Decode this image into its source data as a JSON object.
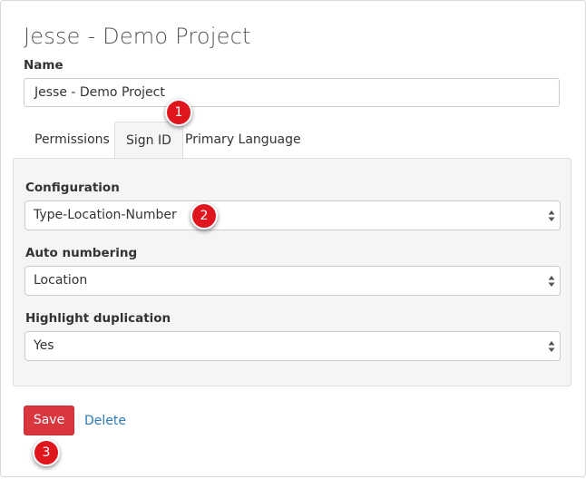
{
  "page": {
    "title": "Jesse - Demo Project"
  },
  "name_field": {
    "label": "Name",
    "value": "Jesse - Demo Project"
  },
  "tabs": [
    {
      "label": "Permissions",
      "active": false
    },
    {
      "label": "Sign ID",
      "active": true
    },
    {
      "label": "Primary Language",
      "active": false
    }
  ],
  "sign_id_panel": {
    "configuration": {
      "label": "Configuration",
      "selected": "Type-Location-Number"
    },
    "auto_numbering": {
      "label": "Auto numbering",
      "selected": "Location"
    },
    "highlight_duplication": {
      "label": "Highlight duplication",
      "selected": "Yes"
    }
  },
  "actions": {
    "save_label": "Save",
    "delete_label": "Delete"
  },
  "annotations": [
    {
      "number": "1"
    },
    {
      "number": "2"
    },
    {
      "number": "3"
    }
  ],
  "colors": {
    "save_button": "#d9363e",
    "delete_link": "#2a7ab8",
    "annotation_marker": "#e0161e",
    "panel_background": "#f5f5f5"
  }
}
